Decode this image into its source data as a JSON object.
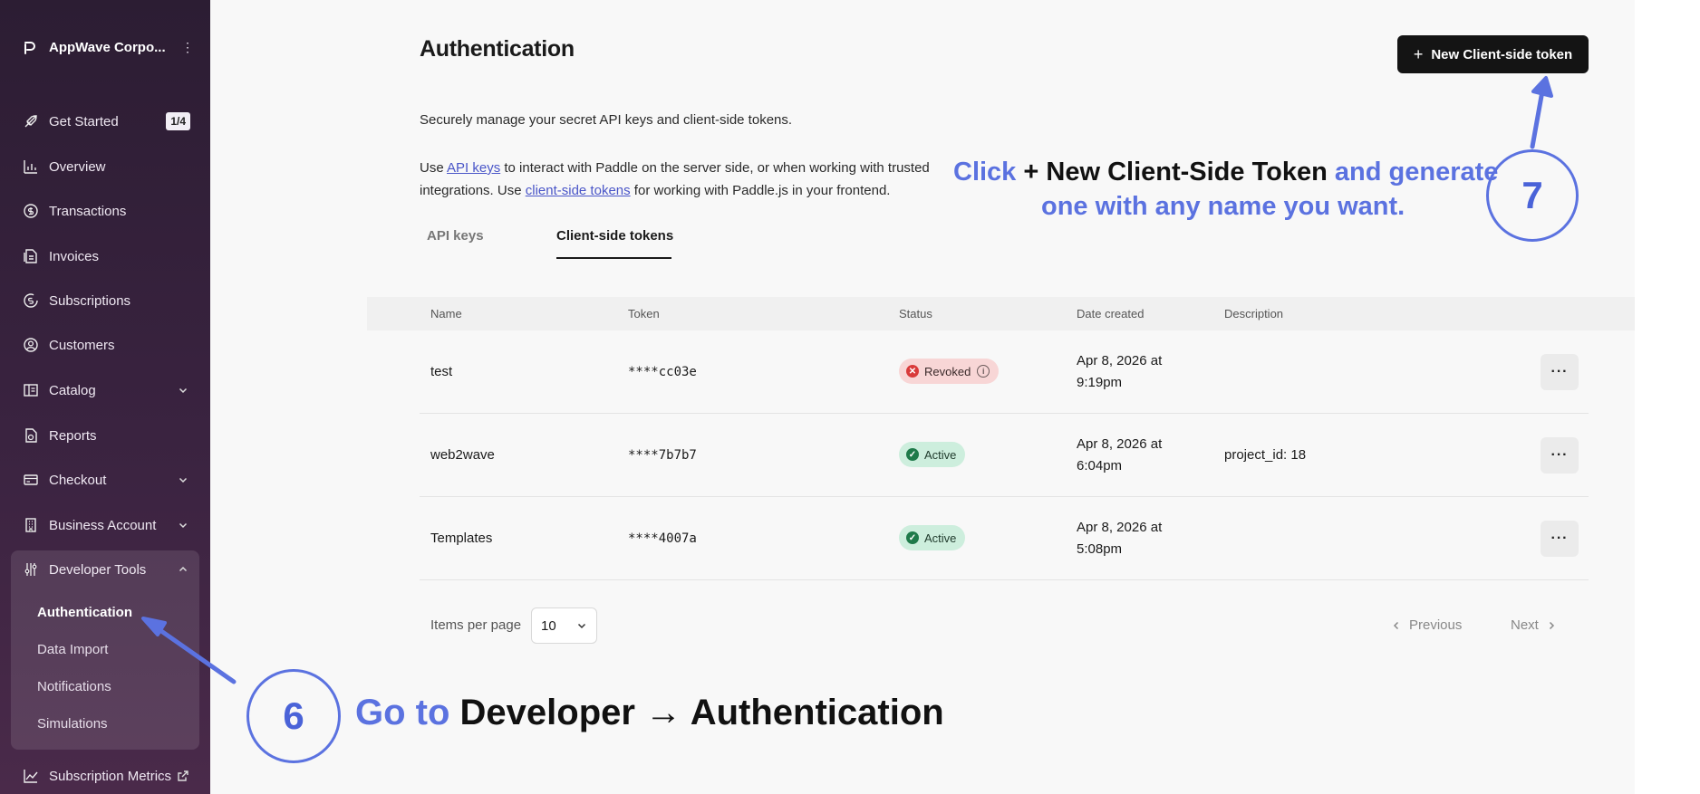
{
  "sidebar": {
    "org_name": "AppWave Corpo...",
    "items": [
      {
        "label": "Get Started",
        "icon": "rocket-icon",
        "badge": "1/4"
      },
      {
        "label": "Overview",
        "icon": "bar-chart-icon"
      },
      {
        "label": "Transactions",
        "icon": "dollar-circle-icon"
      },
      {
        "label": "Invoices",
        "icon": "invoice-icon"
      },
      {
        "label": "Subscriptions",
        "icon": "subscription-icon"
      },
      {
        "label": "Customers",
        "icon": "user-circle-icon"
      },
      {
        "label": "Catalog",
        "icon": "catalog-icon"
      },
      {
        "label": "Reports",
        "icon": "report-icon"
      },
      {
        "label": "Checkout",
        "icon": "credit-card-icon"
      },
      {
        "label": "Business Account",
        "icon": "building-icon"
      },
      {
        "label": "Developer Tools",
        "icon": "sliders-icon"
      }
    ],
    "developer_sub": [
      "Authentication",
      "Data Import",
      "Notifications",
      "Simulations"
    ],
    "bottom_item": {
      "label": "Subscription Metrics",
      "icon": "trend-icon"
    }
  },
  "page": {
    "title": "Authentication",
    "new_button": "New Client-side token",
    "intro_1": "Securely manage your secret API keys and client-side tokens.",
    "intro_2_a": "Use ",
    "intro_2_link1": "API keys",
    "intro_2_b": " to interact with Paddle on the server side, or when working with trusted integrations. Use ",
    "intro_2_link2": "client-side tokens",
    "intro_2_c": " for working with Paddle.js in your frontend.",
    "tabs": [
      "API keys",
      "Client-side tokens"
    ],
    "active_tab": "Client-side tokens"
  },
  "table": {
    "columns": [
      "Name",
      "Token",
      "Status",
      "Date created",
      "Description"
    ],
    "rows": [
      {
        "name": "test",
        "token": "****cc03e",
        "status": "Revoked",
        "date_line1": "Apr 8, 2026 at",
        "date_line2": "9:19pm",
        "description": ""
      },
      {
        "name": "web2wave",
        "token": "****7b7b7",
        "status": "Active",
        "date_line1": "Apr 8, 2026 at",
        "date_line2": "6:04pm",
        "description": "project_id: 18"
      },
      {
        "name": "Templates",
        "token": "****4007a",
        "status": "Active",
        "date_line1": "Apr 8, 2026 at",
        "date_line2": "5:08pm",
        "description": ""
      }
    ],
    "more_label": "···"
  },
  "pagination": {
    "items_per_page_label": "Items per page",
    "items_per_page_value": "10",
    "previous": "Previous",
    "next": "Next"
  },
  "annotations": {
    "step7_number": "7",
    "step7_line1_a": "Click",
    "step7_line1_b": "+ New Client-Side Token",
    "step7_line1_c": "and generate",
    "step7_line2": "one with any name you want.",
    "step6_number": "6",
    "step6_a": "Go to",
    "step6_b": "Developer → Authentication",
    "color": "#5b72e0"
  },
  "colors": {
    "sidebar_bg": "#2c1d33",
    "primary_button": "#141414",
    "revoked_bg": "#f8d6d6",
    "active_bg": "#cdeedd",
    "link": "#4a56c8"
  }
}
